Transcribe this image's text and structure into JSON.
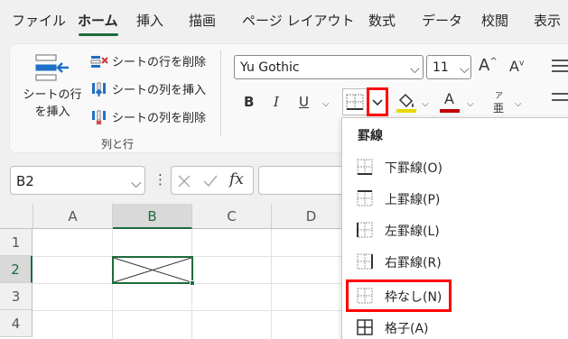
{
  "menu": {
    "items": [
      "ファイル",
      "ホーム",
      "挿入",
      "描画",
      "ページ レイアウト",
      "数式",
      "データ",
      "校閲",
      "表示"
    ],
    "active": "ホーム"
  },
  "ribbon": {
    "insert_label_line1": "シートの行",
    "insert_label_line2": "を挿入",
    "row_commands": [
      "シートの行を削除",
      "シートの列を挿入",
      "シートの列を削除"
    ],
    "group_label": "列と行",
    "font_name": "Yu Gothic",
    "font_size": "11",
    "grow_font": "A",
    "shrink_font": "A",
    "bold": "B",
    "italic": "I",
    "underline": "U",
    "font_color_letter": "A",
    "phonetic_top": "ア",
    "phonetic_bottom": "亜"
  },
  "formula_bar": {
    "name_box": "B2",
    "fx": "fx",
    "more": "⋮"
  },
  "grid": {
    "columns": [
      "A",
      "B",
      "C",
      "D"
    ],
    "rows": [
      "1",
      "2",
      "3",
      "4"
    ],
    "selected_cell": "B2"
  },
  "border_menu": {
    "title": "罫線",
    "items": [
      "下罫線(O)",
      "上罫線(P)",
      "左罫線(L)",
      "右罫線(R)",
      "枠なし(N)",
      "格子(A)"
    ]
  },
  "colors": {
    "accent": "#1e6b3c",
    "highlight": "#ff0000",
    "fill_bar": "#e6d800",
    "font_bar": "#c00000"
  }
}
